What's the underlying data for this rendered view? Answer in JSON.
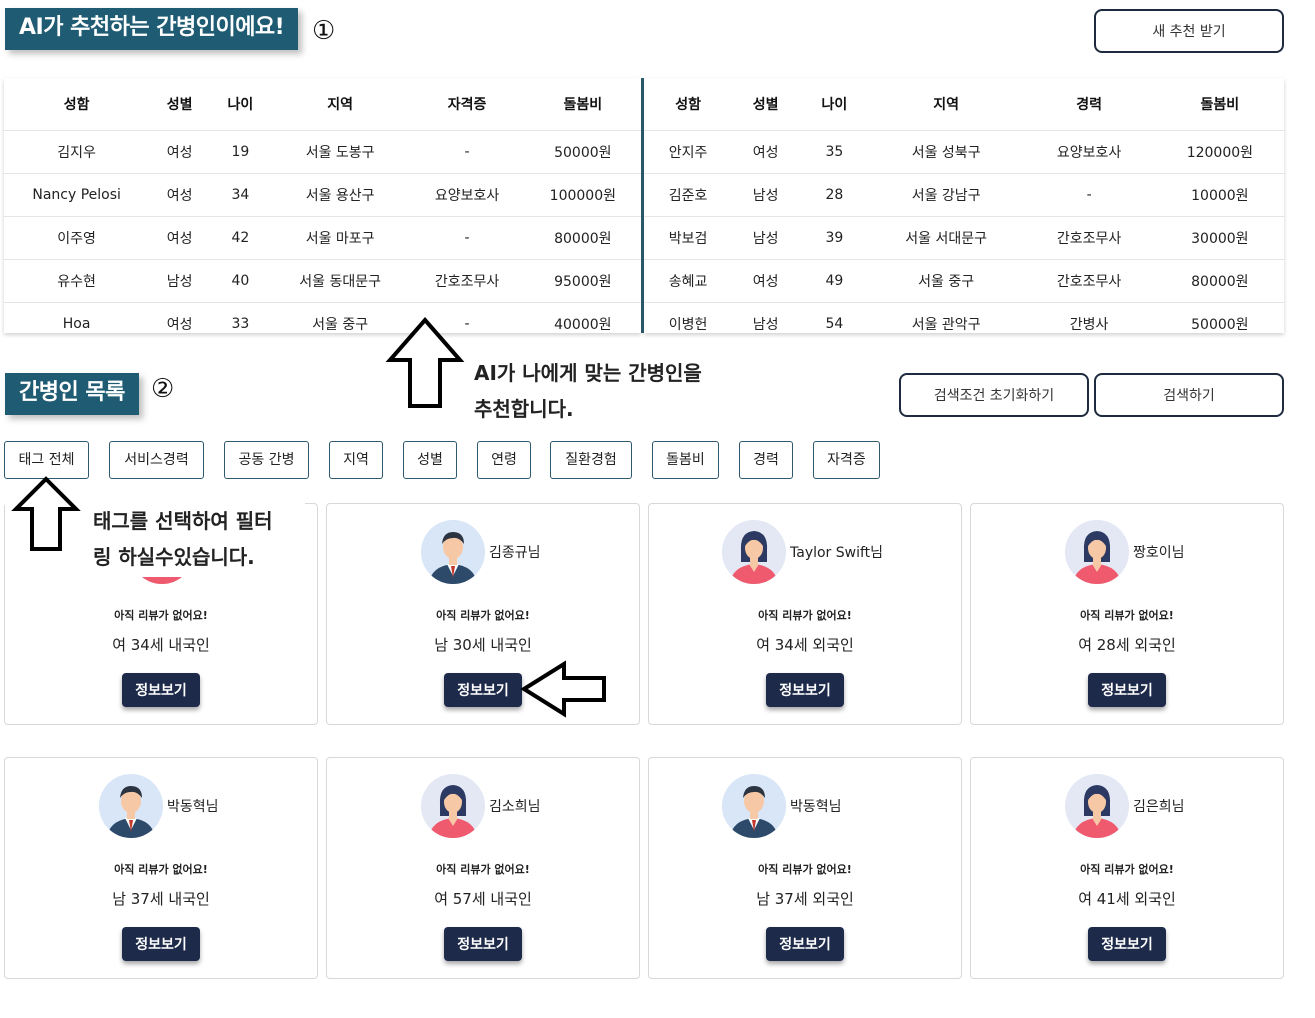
{
  "header": {
    "ai_title": "AI가 추천하는 간병인이에요!",
    "ai_marker": "①",
    "new_recommend_button": "새 추천 받기"
  },
  "recommend_table_left": {
    "columns": [
      "성함",
      "성별",
      "나이",
      "지역",
      "자격증",
      "돌봄비"
    ],
    "rows": [
      [
        "김지우",
        "여성",
        "19",
        "서울 도봉구",
        "-",
        "50000원"
      ],
      [
        "Nancy Pelosi",
        "여성",
        "34",
        "서울 용산구",
        "요양보호사",
        "100000원"
      ],
      [
        "이주영",
        "여성",
        "42",
        "서울 마포구",
        "-",
        "80000원"
      ],
      [
        "유수현",
        "남성",
        "40",
        "서울 동대문구",
        "간호조무사",
        "95000원"
      ],
      [
        "Hoa",
        "여성",
        "33",
        "서울 중구",
        "-",
        "40000원"
      ]
    ]
  },
  "recommend_table_right": {
    "columns": [
      "성함",
      "성별",
      "나이",
      "지역",
      "경력",
      "돌봄비"
    ],
    "rows": [
      [
        "안지주",
        "여성",
        "35",
        "서울 성북구",
        "요양보호사",
        "120000원"
      ],
      [
        "김준호",
        "남성",
        "28",
        "서울 강남구",
        "-",
        "10000원"
      ],
      [
        "박보검",
        "남성",
        "39",
        "서울 서대문구",
        "간호조무사",
        "30000원"
      ],
      [
        "송혜교",
        "여성",
        "49",
        "서울 중구",
        "간호조무사",
        "80000원"
      ],
      [
        "이병헌",
        "남성",
        "54",
        "서울 관악구",
        "간병사",
        "50000원"
      ]
    ]
  },
  "annotations": {
    "ai_line1": "AI가 나에게 맞는 간병인을",
    "ai_line2": "추천합니다.",
    "tag_line1": "태그를 선택하여 필터",
    "tag_line2": "링 하실수있습니다."
  },
  "list_section": {
    "title": "간병인 목록",
    "marker": "②",
    "reset_button": "검색조건 초기화하기",
    "search_button": "검색하기"
  },
  "tags": [
    "태그 전체",
    "서비스경력",
    "공동 간병",
    "지역",
    "성별",
    "연령",
    "질환경험",
    "돌봄비",
    "경력",
    "자격증"
  ],
  "cards": [
    {
      "name": "",
      "gender": "female",
      "review": "아직 리뷰가 없어요!",
      "meta": "여 34세 내국인",
      "button": "정보보기"
    },
    {
      "name": "김종규님",
      "gender": "male",
      "review": "아직 리뷰가 없어요!",
      "meta": "남 30세 내국인",
      "button": "정보보기"
    },
    {
      "name": "Taylor Swift님",
      "gender": "female",
      "review": "아직 리뷰가 없어요!",
      "meta": "여 34세 외국인",
      "button": "정보보기"
    },
    {
      "name": "짱호이님",
      "gender": "female",
      "review": "아직 리뷰가 없어요!",
      "meta": "여 28세 외국인",
      "button": "정보보기"
    },
    {
      "name": "박동혁님",
      "gender": "male",
      "review": "아직 리뷰가 없어요!",
      "meta": "남 37세 내국인",
      "button": "정보보기"
    },
    {
      "name": "김소희님",
      "gender": "female",
      "review": "아직 리뷰가 없어요!",
      "meta": "여 57세 내국인",
      "button": "정보보기"
    },
    {
      "name": "박동혁님",
      "gender": "male",
      "review": "아직 리뷰가 없어요!",
      "meta": "남 37세 외국인",
      "button": "정보보기"
    },
    {
      "name": "김은희님",
      "gender": "female",
      "review": "아직 리뷰가 없어요!",
      "meta": "여 41세 외국인",
      "button": "정보보기"
    }
  ],
  "colors": {
    "accent": "#1f5c73",
    "button_dark": "#1d2a4a"
  }
}
